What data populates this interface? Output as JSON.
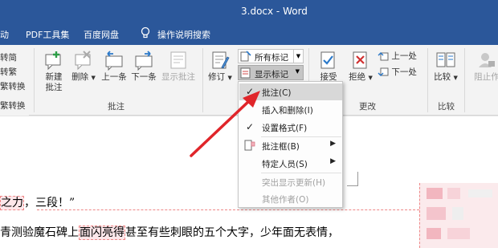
{
  "window": {
    "title": "3.docx  -  Word"
  },
  "tabs": [
    {
      "label": "动"
    },
    {
      "label": "PDF工具集"
    },
    {
      "label": "百度网盘"
    },
    {
      "label": "操作说明搜索"
    }
  ],
  "left_panel": {
    "items": [
      "转简",
      "转繁",
      "繁转换",
      "繁转换"
    ]
  },
  "ribbon": {
    "comments_group": {
      "label": "批注",
      "new_comment": "新建\n批注",
      "delete": "删除",
      "previous": "上一条",
      "next": "下一条",
      "show_comments": "显示批注"
    },
    "tracking": {
      "track_changes": "修订",
      "markup_select": "所有标记",
      "show_markup": "显示标记"
    },
    "changes_group": {
      "label": "更改",
      "accept": "接受",
      "reject": "拒绝",
      "prev": "上一处",
      "next": "下一处"
    },
    "compare_group": {
      "label": "比较",
      "compare": "比较"
    },
    "protect": {
      "block_authors": "阻止作"
    }
  },
  "show_markup_menu": {
    "items": [
      {
        "label": "批注(C)",
        "checked": true,
        "selected": true,
        "submenu": false,
        "disabled": false
      },
      {
        "label": "插入和删除(I)",
        "checked": false,
        "selected": false,
        "submenu": false,
        "disabled": false
      },
      {
        "label": "设置格式(F)",
        "checked": true,
        "selected": false,
        "submenu": false,
        "disabled": false
      },
      {
        "label": "批注框(B)",
        "checked": false,
        "selected": false,
        "submenu": true,
        "disabled": false
      },
      {
        "label": "特定人员(S)",
        "checked": false,
        "selected": false,
        "submenu": true,
        "disabled": false
      },
      {
        "label": "突出显示更新(H)",
        "checked": false,
        "selected": false,
        "submenu": false,
        "disabled": true
      },
      {
        "label": "其他作者(O)",
        "checked": false,
        "selected": false,
        "submenu": false,
        "disabled": true
      }
    ]
  },
  "document": {
    "line1_hl": "之力",
    "line1_rest": "，三段！”",
    "line2_a": "青测验魔石碑上",
    "line2_hl": "面闪亮得",
    "line2_b": "甚至有些刺眼的五个大字，少年面无表情，"
  },
  "colors": {
    "brand": "#2b579a",
    "arrow": "#e0252a"
  }
}
